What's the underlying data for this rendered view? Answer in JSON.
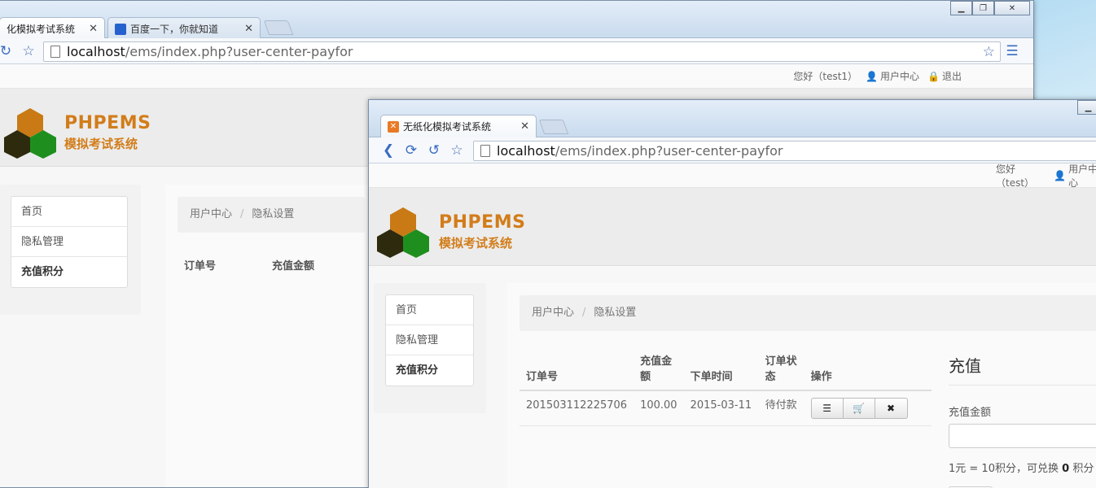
{
  "back_window": {
    "tabs": [
      {
        "label": "化模拟考试系统"
      },
      {
        "label": "百度一下，你就知道"
      }
    ],
    "url_host": "localhost",
    "url_path": "/ems/index.php?user-center-payfor",
    "topbar": {
      "greeting": "您好（test1）",
      "user_center": "用户中心",
      "logout": "退出"
    },
    "brand_en": "PHPEMS",
    "brand_zh": "模拟考试系统",
    "menu": [
      "首页",
      "隐私管理",
      "充值积分"
    ],
    "breadcrumb": [
      "用户中心",
      "隐私设置"
    ],
    "columns": [
      "订单号",
      "充值金额"
    ]
  },
  "front_window": {
    "tab_label": "无纸化模拟考试系统",
    "url_host": "localhost",
    "url_path": "/ems/index.php?user-center-payfor",
    "topbar": {
      "greeting": "您好（test）",
      "user_center": "用户中心"
    },
    "brand_en": "PHPEMS",
    "brand_zh": "模拟考试系统",
    "menu": [
      "首页",
      "隐私管理",
      "充值积分"
    ],
    "breadcrumb": [
      "用户中心",
      "隐私设置"
    ],
    "table": {
      "headers": [
        "订单号",
        "充值金额",
        "下单时间",
        "订单状态",
        "操作"
      ],
      "rows": [
        {
          "order_no": "201503112225706",
          "amount": "100.00",
          "time": "2015-03-11",
          "status": "待付款"
        }
      ]
    },
    "recharge": {
      "title": "充值",
      "amount_label": "充值金额",
      "note_prefix": "1元 = 10积分，可兑换",
      "note_value": "0",
      "note_suffix": "积分"
    }
  },
  "colors": {
    "brand": "#d27d1a",
    "hex_orange": "#c97a14",
    "hex_green": "#1e8f1e",
    "hex_dark": "#2d2a0e"
  }
}
